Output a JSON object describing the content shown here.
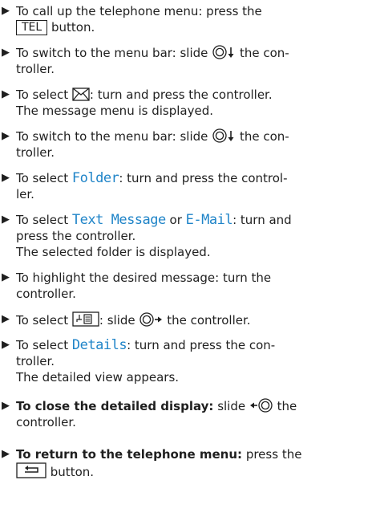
{
  "steps": [
    {
      "parts": {
        "a": "To call up the telephone menu: press the",
        "key": "TEL",
        "b": "button."
      }
    },
    {
      "parts": {
        "a": "To switch to the menu bar: slide",
        "b": "the con-",
        "c": "troller."
      }
    },
    {
      "parts": {
        "a": "To select",
        "b": ": turn and press the controller.",
        "c": "The message menu is displayed."
      }
    },
    {
      "parts": {
        "a": "To switch to the menu bar: slide",
        "b": "the con-",
        "c": "troller."
      }
    },
    {
      "parts": {
        "a": "To select",
        "hl": "Folder",
        "b": ": turn and press the control-",
        "c": "ler."
      }
    },
    {
      "parts": {
        "a": "To select",
        "hl1": "Text Message",
        "or": "or",
        "hl2": "E-Mail",
        "b": ": turn and",
        "c": "press the controller.",
        "d": "The selected folder is displayed."
      }
    },
    {
      "parts": {
        "a": "To highlight the desired message: turn the",
        "c": "controller."
      }
    },
    {
      "parts": {
        "a": "To select",
        "b": ": slide",
        "c": "the controller."
      }
    },
    {
      "parts": {
        "a": "To select",
        "hl": "Details",
        "b": ": turn and press the con-",
        "c": "troller.",
        "d": "The detailed view appears."
      }
    },
    {
      "parts": {
        "bold": "To close the detailed display:",
        "a": "slide",
        "b": "the",
        "c": "controller."
      }
    },
    {
      "parts": {
        "bold": "To return to the telephone menu:",
        "a": "press the",
        "b": "button."
      }
    }
  ],
  "icons": {
    "bullet": "triangle-bullet",
    "controller_down": "controller-slide-down-icon",
    "controller_right": "controller-slide-right-icon",
    "controller_left": "controller-slide-left-icon",
    "envelope": "envelope-icon",
    "menu_symbol": "menu-symbol-icon",
    "back": "back-button-icon"
  },
  "colors": {
    "text": "#1f1f1f",
    "highlight": "#1f84c8"
  }
}
